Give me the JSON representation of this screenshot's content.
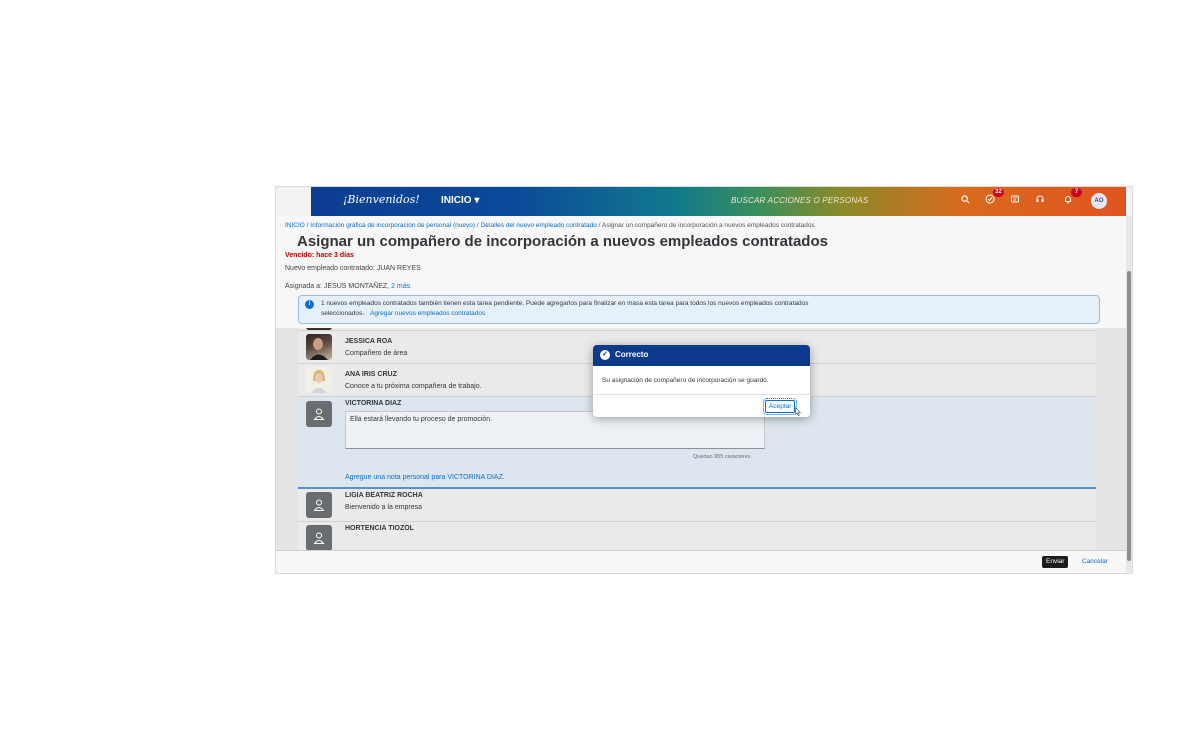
{
  "topbar": {
    "logo_text": "¡Bienvenidos!",
    "home_label": "INICIO ▾",
    "search_placeholder": "BUSCAR ACCIONES O PERSONAS",
    "tasks_badge": "32",
    "notifications_badge": "7",
    "avatar_initials": "AO"
  },
  "header": {
    "breadcrumb": {
      "home": "INICIO",
      "sep": " / ",
      "step1": "Información gráfica de incorporación de personal (nuevo)",
      "step2": "Detalles del nuevo empleado contratado",
      "current": "Asignar un compañero de incorporación a nuevos empleados contratados"
    },
    "title": "Asignar un compañero de incorporación a nuevos empleados contratados",
    "overdue": "Vencido: hace 3 días",
    "new_hire": "Nuevo empleado contratado: JUAN REYES",
    "assigned_prefix": "Asignada a: JESUS MONTAÑEZ, ",
    "assigned_more": "2 más",
    "info_line1": "1 nuevos empleados contratados también tienen esta tarea pendiente. Puede agregarlos para finalizar en masa esta tarea para todos los nuevos empleados contratados",
    "info_line2": "seleccionados.",
    "info_link": "Agregar nuevos empleados contratados"
  },
  "rows": [
    {
      "name": "JESSICA ROA",
      "note": "Compañero de área"
    },
    {
      "name": "ANA IRIS CRUZ",
      "note": "Conoce a tu próxima compañera de trabajo."
    },
    {
      "name": "VICTORINA DIAZ",
      "note": "Ella estará llevando tu proceso de promoción.",
      "chars_left": "Quedan 955 caracteres",
      "add_note": "Agregue una nota personal para VICTORINA DIAZ.",
      "required_mark": "*"
    },
    {
      "name": "LIGIA BEATRIZ ROCHA",
      "note": "Bienvenido a la empresa"
    },
    {
      "name": "HORTENCIA TIOZOL",
      "note": ""
    }
  ],
  "footer": {
    "send_label": "Enviar",
    "cancel_label": "Cancelar"
  },
  "modal": {
    "title": "Correcto",
    "message": "Su asignación de compañero de incorporación se guardó.",
    "ok_label": "Aceptar"
  },
  "colors": {
    "modal_header": "#0b3a8c",
    "link": "#0a6ed1",
    "overdue": "#bb0000"
  }
}
